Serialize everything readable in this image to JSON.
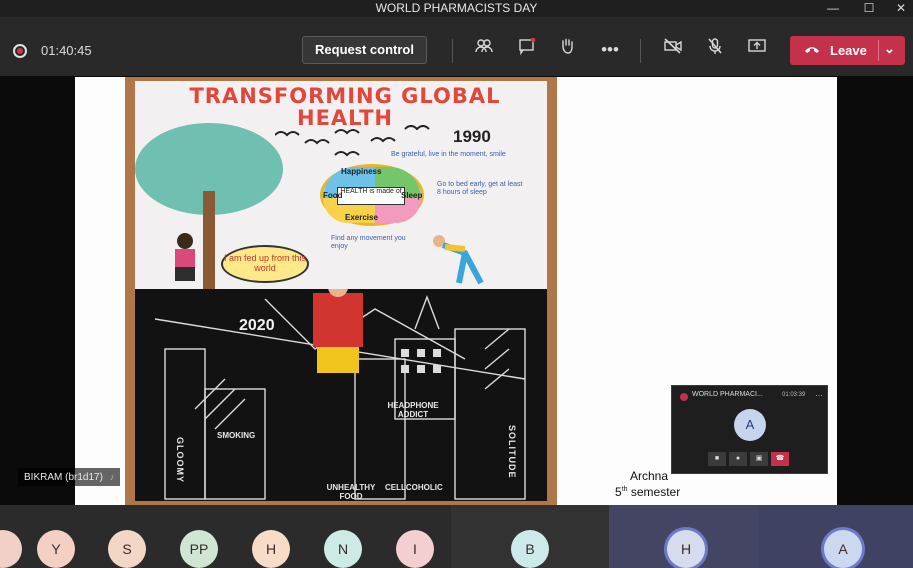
{
  "window": {
    "title": "WORLD PHARMACISTS DAY",
    "controls": [
      "—",
      "☐",
      "✕"
    ]
  },
  "toolbar": {
    "timer": "01:40:45",
    "request_control": "Request control",
    "icons": [
      "participants-icon",
      "chat-icon",
      "raise-hand-icon",
      "more-icon",
      "camera-off-icon",
      "mic-off-icon",
      "share-icon"
    ],
    "leave_label": "Leave",
    "leave_color": "#c4314b"
  },
  "poster": {
    "title_line1": "TRANSFORMING GLOBAL",
    "title_line2": "HEALTH",
    "year_top": "1990",
    "year_bottom": "2020",
    "speech": "I am fed up from this world",
    "wheel": {
      "center": "HEALTH is made of",
      "happiness": "Happiness",
      "sleep": "Sleep",
      "exercise": "Exercise",
      "food": "Food"
    },
    "notes": [
      "Be grateful, live in the moment, smile",
      "Go to bed early, get at least 8 hours of sleep",
      "Find any movement you enjoy"
    ],
    "chalk_labels": {
      "smoking": "SMOKING",
      "headphone": "HEADPHONE ADDICT",
      "unhealthy_food": "UNHEALTHY FOOD",
      "cellcoholic": "CELLCOHOLIC",
      "gloomy": "GLOOMY",
      "solitude": "SOLITUDE"
    }
  },
  "mini_window": {
    "title": "WORLD PHARMACI...",
    "time": "01:03:39",
    "avatar": "A"
  },
  "presenter_tag": "BIKRAM (br1d17)",
  "caption": {
    "name": "Archna",
    "semester_num": "5",
    "semester_sup": "th",
    "semester_word": "semester"
  },
  "participants": [
    {
      "initials": "Y",
      "color": "#f4cfc4"
    },
    {
      "initials": "S",
      "color": "#f2d6c6"
    },
    {
      "initials": "PP",
      "color": "#cfe6d2"
    },
    {
      "initials": "H",
      "color": "#f7dcc8"
    },
    {
      "initials": "N",
      "color": "#cdebe6"
    },
    {
      "initials": "I",
      "color": "#f3cfd0"
    },
    {
      "initials": "B",
      "color": "#cdeaea"
    },
    {
      "initials": "H",
      "color": "#d6dbee"
    },
    {
      "initials": "A",
      "color": "#cbd8ef"
    }
  ]
}
